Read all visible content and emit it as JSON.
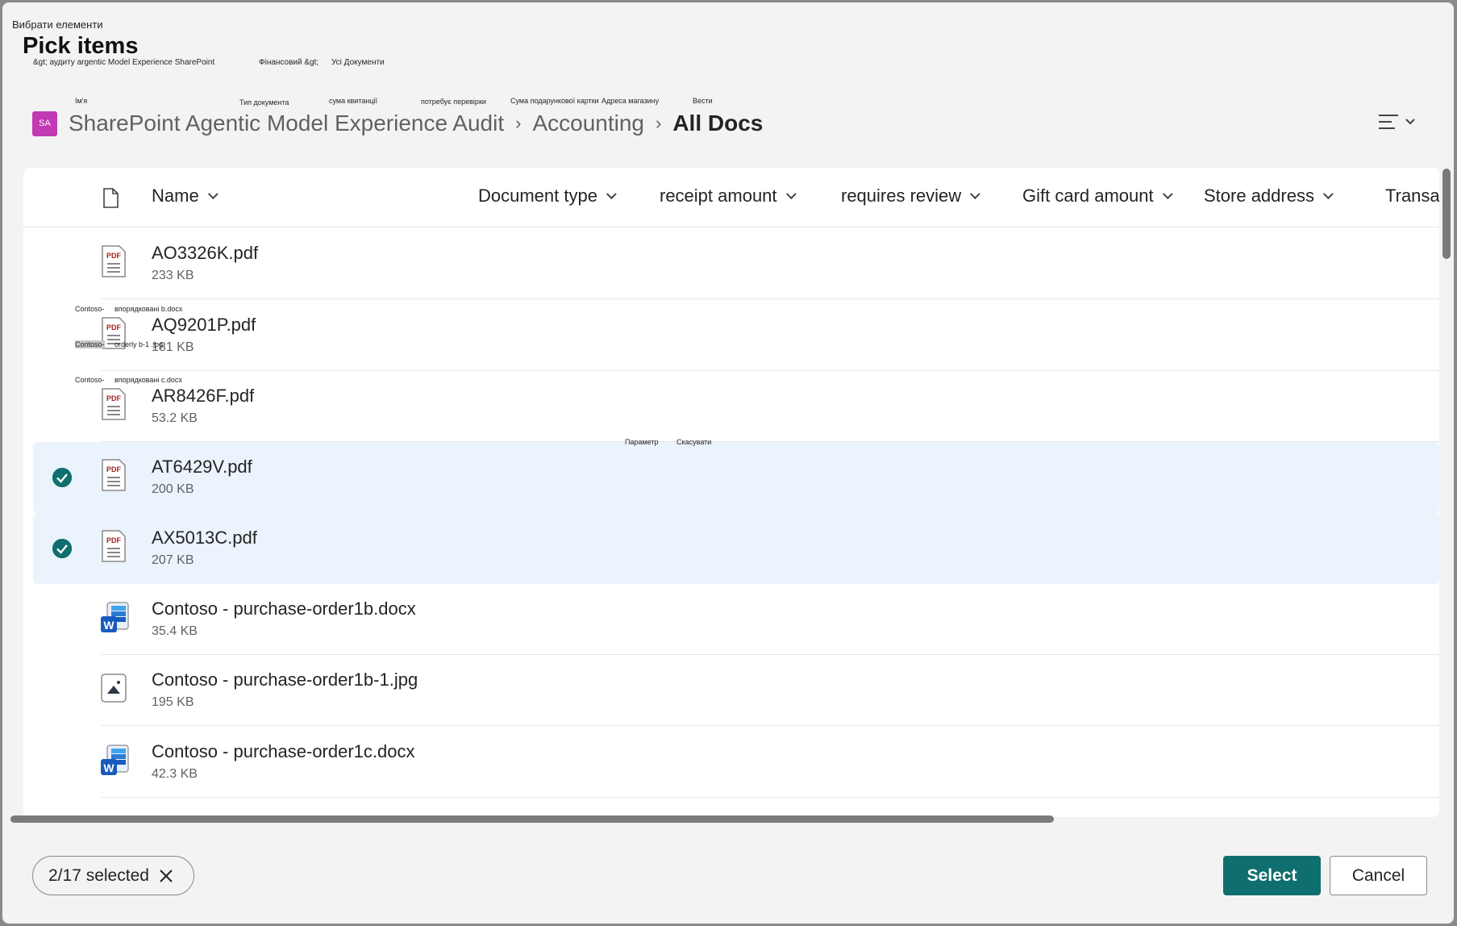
{
  "window": {
    "overlay_title": "Вибрати елементи",
    "title": "Pick items",
    "overlay_breadcrumb_1": "&gt; аудиту argentic Model Experience SharePoint",
    "overlay_breadcrumb_2": "Фінансовий &gt;",
    "overlay_breadcrumb_3": "Усі Документи"
  },
  "overlay_columns": {
    "name": "Ім'я",
    "document_type": "Тип документа",
    "receipt_amount": "сума квитанції",
    "requires_review": "потребує перевірки",
    "gift_card_amount": "Сума подарункової картки",
    "store_address": "Адреса магазину",
    "transaction": "Вести"
  },
  "overlay_rows": {
    "row1_prefix": "Contoso-",
    "row1_name": "впорядковані b.docx",
    "row2_prefix": "Contoso-",
    "row2_name": "orderly b-1 .jpg",
    "row3_prefix": "Contoso-",
    "row3_name": "впорядковані с.docx"
  },
  "overlay_actions": {
    "option": "Параметр",
    "cancel": "Скасувати"
  },
  "breadcrumb": {
    "site_badge": "SA",
    "site": "SharePoint Agentic Model Experience Audit",
    "library": "Accounting",
    "view": "All Docs",
    "site_badge_color": "#c239b3"
  },
  "columns": {
    "name": "Name",
    "document_type": "Document type",
    "receipt_amount": "receipt amount",
    "requires_review": "requires review",
    "gift_card_amount": "Gift card amount",
    "store_address": "Store address",
    "transaction": "Transac"
  },
  "files": [
    {
      "name": "AO3326K.pdf",
      "size": "233 KB",
      "icon": "pdf-icon",
      "selected": false
    },
    {
      "name": "AQ9201P.pdf",
      "size": "181 KB",
      "icon": "pdf-icon",
      "selected": false
    },
    {
      "name": "AR8426F.pdf",
      "size": "53.2 KB",
      "icon": "pdf-icon",
      "selected": false
    },
    {
      "name": "AT6429V.pdf",
      "size": "200 KB",
      "icon": "pdf-icon",
      "selected": true
    },
    {
      "name": "AX5013C.pdf",
      "size": "207 KB",
      "icon": "pdf-icon",
      "selected": true
    },
    {
      "name": "Contoso - purchase-order1b.docx",
      "size": "35.4 KB",
      "icon": "word-icon",
      "selected": false
    },
    {
      "name": "Contoso - purchase-order1b-1.jpg",
      "size": "195 KB",
      "icon": "image-icon",
      "selected": false
    },
    {
      "name": "Contoso - purchase-order1c.docx",
      "size": "42.3 KB",
      "icon": "word-icon",
      "selected": false
    }
  ],
  "footer": {
    "selection_count": "2/17 selected",
    "select_label": "Select",
    "cancel_label": "Cancel"
  },
  "colors": {
    "accent": "#0f6f6e",
    "selected_row": "#ebf3fc"
  }
}
